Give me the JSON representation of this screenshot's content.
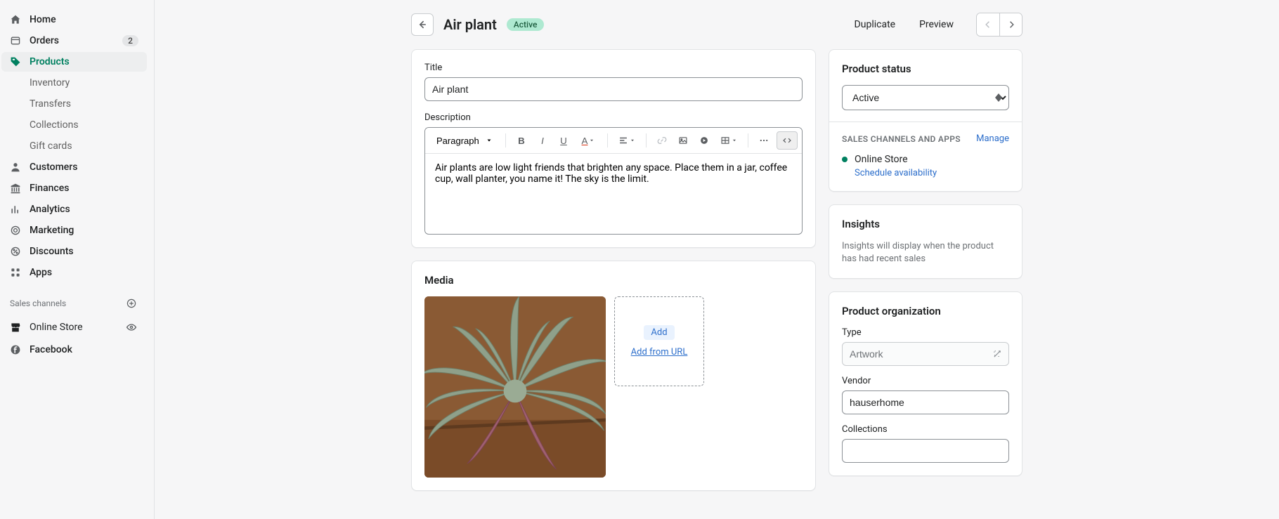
{
  "sidebar": {
    "items": [
      {
        "label": "Home"
      },
      {
        "label": "Orders",
        "badge": "2"
      },
      {
        "label": "Products"
      },
      {
        "label": "Inventory"
      },
      {
        "label": "Transfers"
      },
      {
        "label": "Collections"
      },
      {
        "label": "Gift cards"
      },
      {
        "label": "Customers"
      },
      {
        "label": "Finances"
      },
      {
        "label": "Analytics"
      },
      {
        "label": "Marketing"
      },
      {
        "label": "Discounts"
      },
      {
        "label": "Apps"
      }
    ],
    "sales_channels_title": "Sales channels",
    "channels": [
      {
        "label": "Online Store"
      },
      {
        "label": "Facebook"
      }
    ]
  },
  "header": {
    "title": "Air plant",
    "status": "Active",
    "duplicate": "Duplicate",
    "preview": "Preview"
  },
  "form": {
    "title_label": "Title",
    "title_value": "Air plant",
    "description_label": "Description",
    "paragraph": "Paragraph",
    "description_value": "Air plants are low light friends that brighten any space. Place them in a jar, coffee cup, wall planter, you name it! The sky is the limit."
  },
  "media": {
    "heading": "Media",
    "add": "Add",
    "add_url": "Add from URL"
  },
  "status": {
    "heading": "Product status",
    "value": "Active",
    "sales_heading": "SALES CHANNELS AND APPS",
    "manage": "Manage",
    "store": "Online Store",
    "schedule": "Schedule availability"
  },
  "insights": {
    "heading": "Insights",
    "text": "Insights will display when the product has had recent sales"
  },
  "org": {
    "heading": "Product organization",
    "type_label": "Type",
    "type_value": "Artwork",
    "vendor_label": "Vendor",
    "vendor_value": "hauserhome",
    "collections_label": "Collections"
  }
}
